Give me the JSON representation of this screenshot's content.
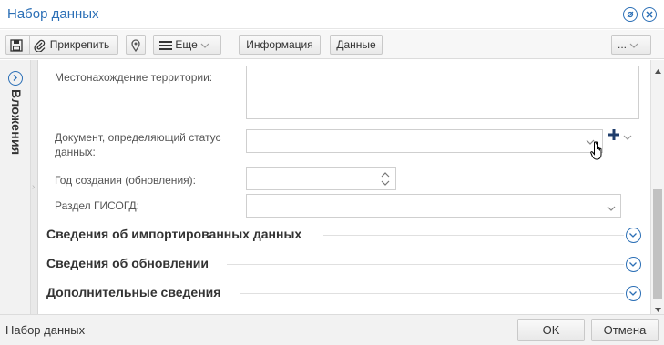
{
  "window": {
    "title": "Набор данных"
  },
  "toolbar": {
    "attach_label": "Прикрепить",
    "more_label": "Еще",
    "info_label": "Информация",
    "data_label": "Данные",
    "overflow_label": "..."
  },
  "sidebar": {
    "label": "Вложения"
  },
  "form": {
    "location_label": "Местонахождение территории:",
    "location_value": "",
    "document_label_line1": "Документ, определяющий статус",
    "document_label_line2": "данных:",
    "document_value": "",
    "year_label": "Год создания (обновления):",
    "year_value": "",
    "section_label": "Раздел ГИСОГД:",
    "section_value": ""
  },
  "sections": [
    {
      "title": "Сведения об импортированных данных"
    },
    {
      "title": "Сведения об обновлении"
    },
    {
      "title": "Дополнительные сведения"
    }
  ],
  "footer": {
    "status": "Набор данных",
    "ok_label": "OK",
    "cancel_label": "Отмена"
  },
  "colors": {
    "accent": "#2b6fb6",
    "title": "#2b6fb6"
  },
  "icons": [
    "save-icon",
    "paperclip-icon",
    "map-pin-icon",
    "menu-icon",
    "chevron-down-icon",
    "plus-icon",
    "circle-chevron-icon",
    "close-icon",
    "settings-icon",
    "hand-cursor-icon"
  ]
}
